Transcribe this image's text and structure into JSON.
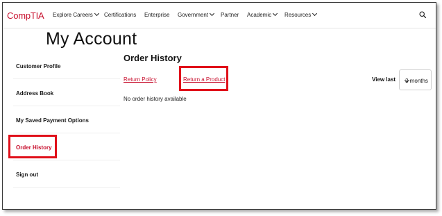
{
  "nav": {
    "logo": "CompTIA",
    "items": [
      {
        "label": "Explore Careers",
        "has_menu": true
      },
      {
        "label": "Certifications",
        "has_menu": false
      },
      {
        "label": "Enterprise",
        "has_menu": false
      },
      {
        "label": "Government",
        "has_menu": true
      },
      {
        "label": "Partner",
        "has_menu": false
      },
      {
        "label": "Academic",
        "has_menu": true
      },
      {
        "label": "Resources",
        "has_menu": true
      }
    ],
    "search_icon": "search-icon"
  },
  "page": {
    "title": "My Account"
  },
  "sidebar": {
    "items": [
      {
        "label": "Customer Profile",
        "active": false
      },
      {
        "label": "Address Book",
        "active": false
      },
      {
        "label": "My Saved Payment Options",
        "active": false
      },
      {
        "label": "Order History",
        "active": true
      },
      {
        "label": "Sign out",
        "active": false
      }
    ]
  },
  "main": {
    "section_title": "Order History",
    "links": {
      "return_policy": "Return Policy",
      "return_product": "Return a Product"
    },
    "empty_message": "No order history available",
    "view_last": {
      "label": "View last",
      "selected": "3 months"
    }
  },
  "colors": {
    "brand": "#c8102e",
    "highlight_box": "#e0101a"
  }
}
